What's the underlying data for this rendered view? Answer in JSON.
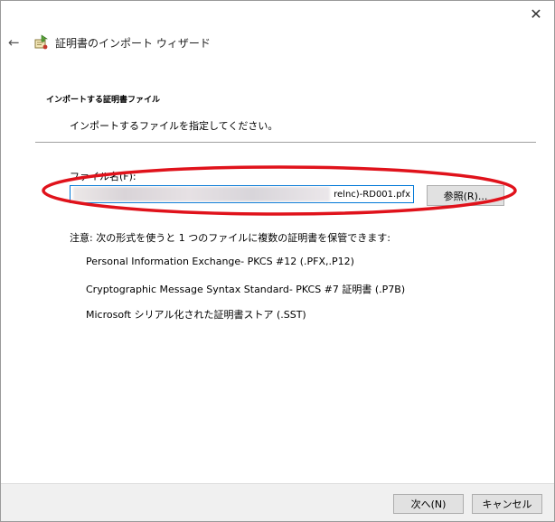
{
  "window": {
    "close_glyph": "✕",
    "back_glyph": "←",
    "title": "証明書のインポート ウィザード"
  },
  "section": {
    "heading": "インポートする証明書ファイル",
    "subheading": "インポートするファイルを指定してください。"
  },
  "file": {
    "label": "ファイル名(F):",
    "value": "relnc)-RD001.pfx",
    "browse_label": "参照(R)..."
  },
  "note": {
    "text": "注意: 次の形式を使うと 1 つのファイルに複数の証明書を保管できます:",
    "formats": [
      "Personal Information Exchange- PKCS #12 (.PFX,.P12)",
      "Cryptographic Message Syntax Standard- PKCS #7 証明書 (.P7B)",
      "Microsoft シリアル化された証明書ストア (.SST)"
    ]
  },
  "footer": {
    "next_label": "次へ(N)",
    "cancel_label": "キャンセル"
  },
  "colors": {
    "highlight": "#e0121b",
    "input_focus": "#0078d7",
    "footer_bg": "#f0f0f0"
  },
  "icons": {
    "wizard": "certificate-wizard-icon",
    "back": "back-arrow-icon",
    "close": "close-icon"
  }
}
